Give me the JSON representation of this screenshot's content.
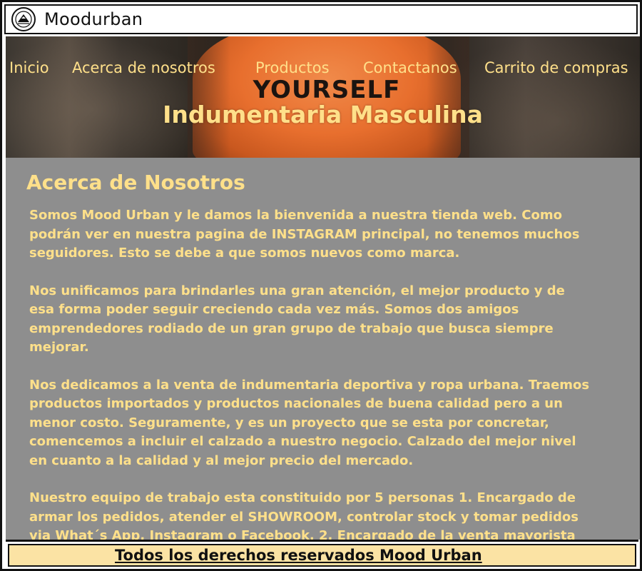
{
  "app": {
    "title": "Moodurban",
    "logo_icon": "mountain-logo-icon"
  },
  "nav": {
    "items": [
      {
        "label": "Inicio"
      },
      {
        "label": "Acerca de nosotros"
      },
      {
        "label": "Productos"
      },
      {
        "label": "Contactanos"
      },
      {
        "label": "Carrito de compras"
      }
    ]
  },
  "hero": {
    "title": "Indumentaria Masculina",
    "print_text": "YOURSELF"
  },
  "about": {
    "title": "Acerca de Nosotros",
    "paragraphs": [
      "Somos Mood Urban y le damos la bienvenida a nuestra tienda web. Como podrán ver en nuestra pagina de INSTAGRAM principal, no tenemos muchos seguidores. Esto se debe a que somos nuevos como marca.",
      "Nos unificamos para brindarles una gran atención, el mejor producto y de esa forma poder seguir creciendo cada vez más. Somos dos amigos emprendedores rodiado de un gran grupo de trabajo que busca siempre mejorar.",
      "Nos dedicamos a la venta de indumentaria deportiva y ropa urbana. Traemos productos importados y productos nacionales de buena calidad pero a un menor costo. Seguramente, y es un proyecto que se esta por concretar, comencemos a incluir el calzado a nuestro negocio. Calzado del mejor nivel en cuanto a la calidad y al mejor precio del mercado.",
      "Nuestro equipo de trabajo esta constituido por 5 personas 1. Encargado de armar los pedidos, atender el SHOWROOM, controlar stock y tomar pedidos via What´s App, Instagram o Facebook. 2. Encargado de la venta mayorista"
    ]
  },
  "footer": {
    "text": "Todos los derechos reservados Mood Urban"
  },
  "colors": {
    "accent_text": "#ffe08a",
    "content_bg": "#8e8e8e",
    "footer_bg": "#fbe3a4"
  }
}
